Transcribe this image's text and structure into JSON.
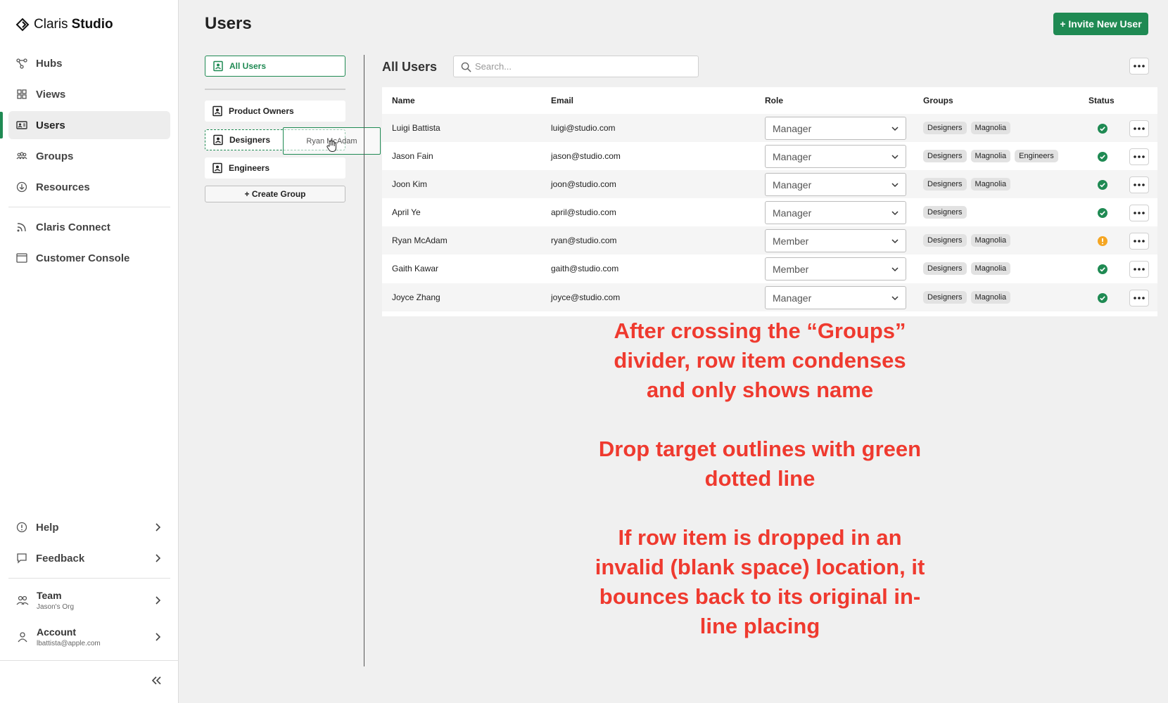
{
  "app": {
    "brand": "Claris",
    "product": "Studio"
  },
  "sidebar": {
    "items": [
      {
        "label": "Hubs",
        "icon": "hubs-icon"
      },
      {
        "label": "Views",
        "icon": "views-icon"
      },
      {
        "label": "Users",
        "icon": "users-icon",
        "active": true
      },
      {
        "label": "Groups",
        "icon": "groups-icon"
      },
      {
        "label": "Resources",
        "icon": "resources-icon"
      },
      {
        "label": "Claris Connect",
        "icon": "rss-icon"
      },
      {
        "label": "Customer Console",
        "icon": "console-icon"
      }
    ],
    "help": "Help",
    "feedback": "Feedback",
    "team": {
      "label": "Team",
      "sub": "Jason's Org"
    },
    "account": {
      "label": "Account",
      "sub": "lbattista@apple.com"
    }
  },
  "page": {
    "title": "Users",
    "invite_label": "+ Invite New User"
  },
  "groups_panel": {
    "all_users": "All Users",
    "groups": [
      "Product Owners",
      "Designers",
      "Engineers"
    ],
    "create_label": "+ Create Group",
    "drag_ghost": "Ryan McAdam"
  },
  "main": {
    "heading": "All Users",
    "search_placeholder": "Search...",
    "columns": {
      "name": "Name",
      "email": "Email",
      "role": "Role",
      "groups": "Groups",
      "status": "Status"
    },
    "rows": [
      {
        "name": "Luigi Battista",
        "email": "luigi@studio.com",
        "role": "Manager",
        "groups": [
          "Designers",
          "Magnolia"
        ],
        "status": "ok"
      },
      {
        "name": "Jason Fain",
        "email": "jason@studio.com",
        "role": "Manager",
        "groups": [
          "Designers",
          "Magnolia",
          "Engineers"
        ],
        "status": "ok"
      },
      {
        "name": "Joon Kim",
        "email": "joon@studio.com",
        "role": "Manager",
        "groups": [
          "Designers",
          "Magnolia"
        ],
        "status": "ok"
      },
      {
        "name": "April Ye",
        "email": "april@studio.com",
        "role": "Manager",
        "groups": [
          "Designers"
        ],
        "status": "ok"
      },
      {
        "name": "Ryan McAdam",
        "email": "ryan@studio.com",
        "role": "Member",
        "groups": [
          "Designers",
          "Magnolia"
        ],
        "status": "warning"
      },
      {
        "name": "Gaith Kawar",
        "email": "gaith@studio.com",
        "role": "Member",
        "groups": [
          "Designers",
          "Magnolia"
        ],
        "status": "ok"
      },
      {
        "name": "Joyce Zhang",
        "email": "joyce@studio.com",
        "role": "Manager",
        "groups": [
          "Designers",
          "Magnolia"
        ],
        "status": "ok"
      }
    ]
  },
  "colors": {
    "accent": "#1f8a53",
    "ok": "#1f8a53",
    "warning": "#f5a623",
    "annotation": "#ef3a2f"
  },
  "annotation": [
    "After crossing the “Groups” divider, row item condenses and only shows name",
    "Drop target outlines with green dotted line",
    "If row item is dropped in an invalid (blank space) location, it bounces back to its original in-line placing"
  ]
}
